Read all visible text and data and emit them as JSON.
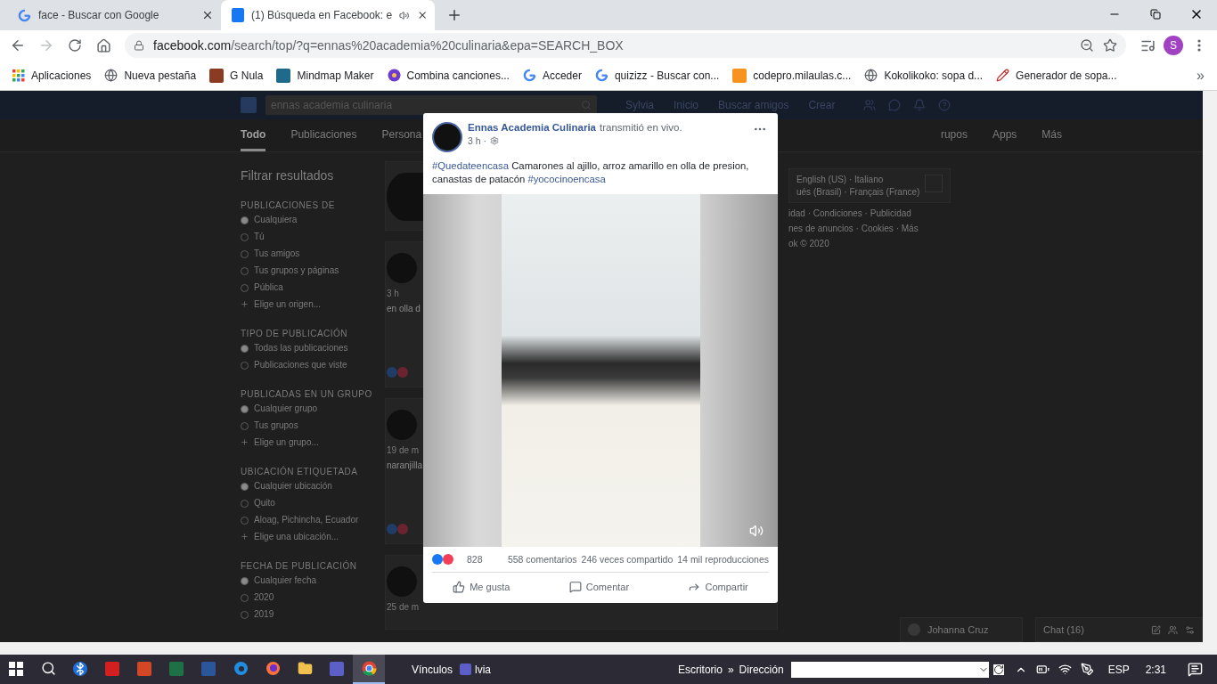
{
  "browser": {
    "tabs": [
      {
        "title": "face - Buscar con Google",
        "kind": "google",
        "selected": false,
        "audio": false
      },
      {
        "title": "(1) Búsqueda en Facebook: e",
        "kind": "facebook",
        "selected": true,
        "audio": true
      }
    ],
    "url": {
      "domain": "facebook.com",
      "path": "/search/top/?q=ennas%20academia%20culinaria&epa=SEARCH_BOX"
    },
    "forward_disabled": true,
    "profile_initial": "S",
    "bookmarks": [
      {
        "label": "Aplicaciones",
        "kind": "apps"
      },
      {
        "label": "Nueva pestaña",
        "kind": "globe"
      },
      {
        "label": "G Nula",
        "kind": "photo"
      },
      {
        "label": "Mindmap Maker",
        "kind": "mindmap"
      },
      {
        "label": "Combina canciones...",
        "kind": "disc"
      },
      {
        "label": "Acceder",
        "kind": "google"
      },
      {
        "label": "quizizz - Buscar con...",
        "kind": "google"
      },
      {
        "label": "codepro.milaulas.c...",
        "kind": "moodle"
      },
      {
        "label": "Kokolikoko: sopa d...",
        "kind": "globe"
      },
      {
        "label": "Generador de sopa...",
        "kind": "pencil"
      }
    ],
    "bookmarks_more": "»"
  },
  "facebook": {
    "search": {
      "value": "ennas academia culinaria"
    },
    "nav": [
      "Sylvia",
      "Inicio",
      "Buscar amigos",
      "Crear"
    ],
    "result_tabs": [
      {
        "label": "Todo",
        "selected": true
      },
      {
        "label": "Publicaciones",
        "selected": false
      },
      {
        "label": "Persona",
        "selected": false
      }
    ],
    "result_tabs_right": [
      {
        "label": "rupos",
        "selected": false
      },
      {
        "label": "Apps",
        "selected": false
      },
      {
        "label": "Más",
        "selected": false
      }
    ],
    "filters": {
      "title": "Filtrar resultados",
      "sections": [
        {
          "heading": "PUBLICACIONES DE",
          "options": [
            {
              "label": "Cualquiera",
              "kind": "radio",
              "selected": true
            },
            {
              "label": "Tú",
              "kind": "radio",
              "selected": false
            },
            {
              "label": "Tus amigos",
              "kind": "radio",
              "selected": false
            },
            {
              "label": "Tus grupos y páginas",
              "kind": "radio",
              "selected": false
            },
            {
              "label": "Pública",
              "kind": "radio",
              "selected": false
            },
            {
              "label": "Elige un origen...",
              "kind": "add"
            }
          ]
        },
        {
          "heading": "TIPO DE PUBLICACIÓN",
          "options": [
            {
              "label": "Todas las publicaciones",
              "kind": "radio",
              "selected": true
            },
            {
              "label": "Publicaciones que viste",
              "kind": "radio",
              "selected": false
            }
          ]
        },
        {
          "heading": "PUBLICADAS EN UN GRUPO",
          "options": [
            {
              "label": "Cualquier grupo",
              "kind": "radio",
              "selected": true
            },
            {
              "label": "Tus grupos",
              "kind": "radio",
              "selected": false
            },
            {
              "label": "Elige un grupo...",
              "kind": "add"
            }
          ]
        },
        {
          "heading": "UBICACIÓN ETIQUETADA",
          "options": [
            {
              "label": "Cualquier ubicación",
              "kind": "radio",
              "selected": true
            },
            {
              "label": "Quito",
              "kind": "radio",
              "selected": false
            },
            {
              "label": "Aloag, Pichincha, Ecuador",
              "kind": "radio",
              "selected": false
            },
            {
              "label": "Elige una ubicación...",
              "kind": "add"
            }
          ]
        },
        {
          "heading": "FECHA DE PUBLICACIÓN",
          "options": [
            {
              "label": "Cualquier fecha",
              "kind": "radio",
              "selected": true
            },
            {
              "label": "2020",
              "kind": "radio",
              "selected": false
            },
            {
              "label": "2019",
              "kind": "radio",
              "selected": false
            }
          ]
        }
      ]
    },
    "results": [
      {
        "time": "3 h",
        "snippet": "en olla d",
        "reactions": true
      },
      {
        "time": "19 de m",
        "snippet": "naranjilla",
        "reactions": true
      },
      {
        "time": "25 de m",
        "reactions": false
      }
    ],
    "languages": [
      "English (US) · Italiano",
      "ués (Brasil) · Français (France)"
    ],
    "footer": [
      "idad · Condiciones · Publicidad",
      "nes de anuncios · Cookies · Más",
      "ok © 2020"
    ],
    "chat": {
      "contact": "Johanna Cruz",
      "label": "Chat (16)"
    }
  },
  "post": {
    "author": "Ennas Academia Culinaria",
    "action": "transmitió en vivo.",
    "time": "3 h ·",
    "text": [
      {
        "kind": "hashtag",
        "text": "#Quedateencasa"
      },
      {
        "kind": "plain",
        "text": " Camarones al ajillo, arroz amarillo en olla de presion, canastas de patacón "
      },
      {
        "kind": "hashtag",
        "text": "#yococinoencasa"
      }
    ],
    "reactions_count": "828",
    "comments": "558 comentarios",
    "shares": "246 veces compartido",
    "views": "14 mil reproducciones",
    "actions": [
      {
        "label": "Me gusta",
        "kind": "like"
      },
      {
        "label": "Comentar",
        "kind": "comment"
      },
      {
        "label": "Compartir",
        "kind": "share"
      }
    ]
  },
  "taskbar": {
    "apps": [
      {
        "kind": "start",
        "selected": false
      },
      {
        "kind": "search",
        "selected": false
      },
      {
        "kind": "bluetooth",
        "selected": false
      },
      {
        "kind": "pdf",
        "selected": false
      },
      {
        "kind": "powerpoint",
        "selected": false
      },
      {
        "kind": "excel",
        "selected": false
      },
      {
        "kind": "word",
        "selected": false
      },
      {
        "kind": "edge",
        "selected": false
      },
      {
        "kind": "firefox",
        "selected": false
      },
      {
        "kind": "folder",
        "selected": false
      },
      {
        "kind": "teams",
        "selected": false
      },
      {
        "kind": "chrome",
        "selected": true
      }
    ],
    "links_label": "Vínculos",
    "pinned": "lvia",
    "desktop": "Escritorio",
    "chevron": "»",
    "address_label": "Dirección",
    "language": "ESP",
    "time": "2:31"
  }
}
